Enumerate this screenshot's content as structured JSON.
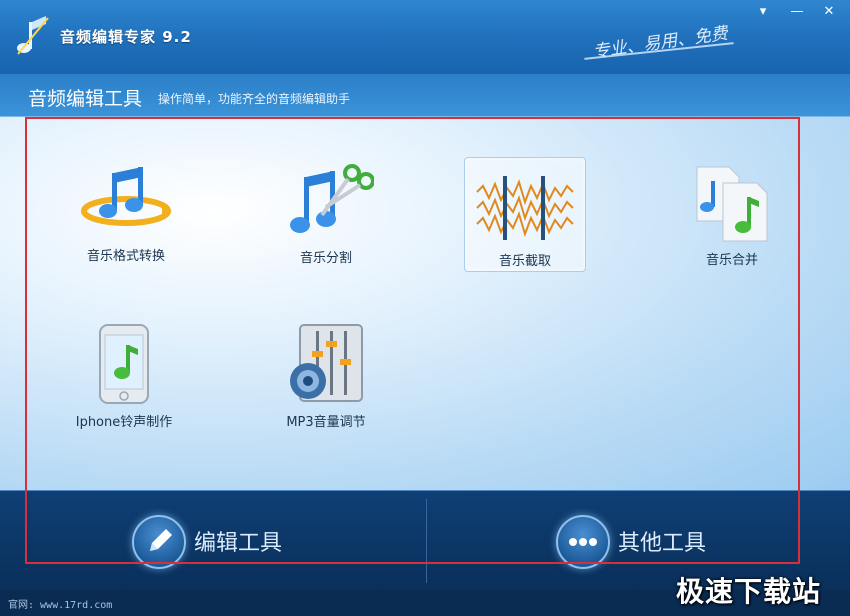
{
  "window": {
    "title": "音频编辑专家 9.2",
    "slogan": "专业、易用、免费",
    "controls": [
      "▾",
      "—",
      "✕"
    ]
  },
  "header": {
    "title": "音频编辑工具",
    "description": "操作简单，功能齐全的音频编辑助手"
  },
  "tools": [
    {
      "label": "音乐格式转换",
      "icon": "music-convert-icon"
    },
    {
      "label": "音乐分割",
      "icon": "music-scissors-icon"
    },
    {
      "label": "音乐截取",
      "icon": "waveform-cut-icon",
      "selected": true
    },
    {
      "label": "音乐合并",
      "icon": "music-merge-icon"
    },
    {
      "label": "Iphone铃声制作",
      "icon": "iphone-ringtone-icon"
    },
    {
      "label": "MP3音量调节",
      "icon": "volume-mixer-icon"
    }
  ],
  "bottom_tabs": [
    {
      "label": "编辑工具",
      "icon": "pencil-icon"
    },
    {
      "label": "其他工具",
      "icon": "more-dots-icon"
    }
  ],
  "status": {
    "website": "官网: www.17rd.com"
  },
  "watermark": "极速下载站",
  "colors": {
    "accent": "#1f6fbb",
    "highlight_frame": "#d8303b"
  }
}
